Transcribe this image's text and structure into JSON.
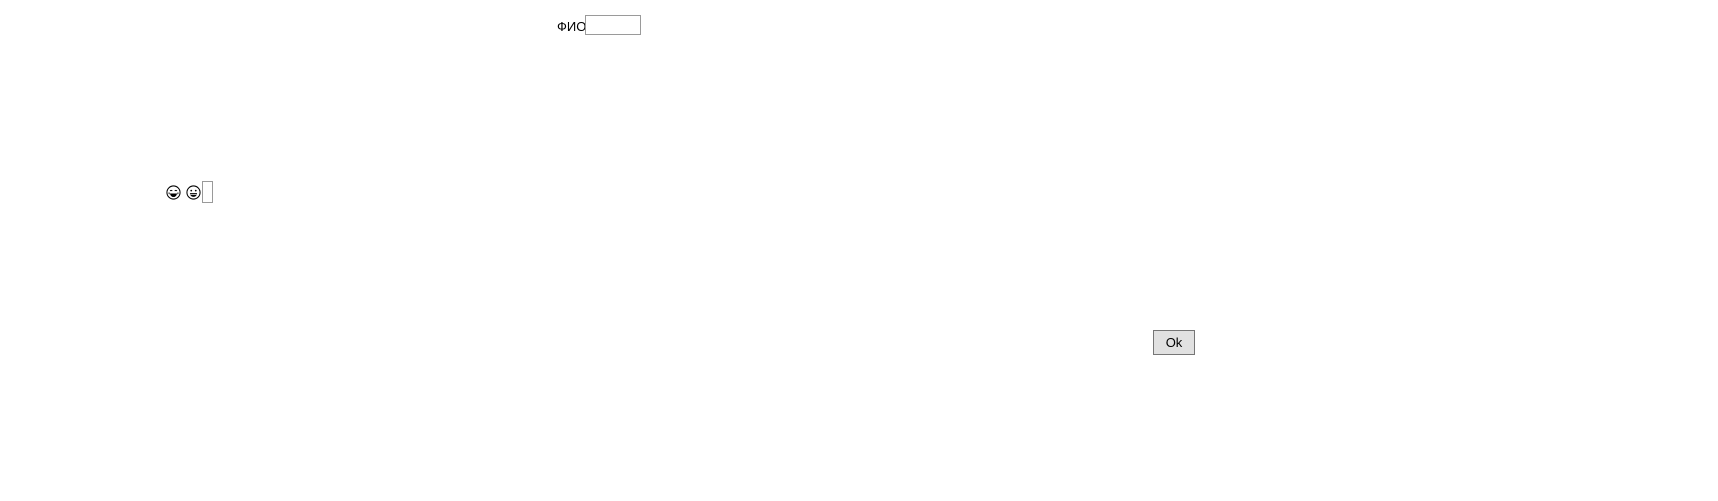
{
  "form": {
    "fio_label": "ФИО",
    "fio_value": "",
    "fio_placeholder": "",
    "emoji_icons": [
      "grinning-tears-face",
      "grinning-face"
    ],
    "emoji_value": "",
    "ok_label": "Ok"
  },
  "colors": {
    "background": "#ffffff",
    "input_border": "#9a9a9a",
    "button_background": "#e1e1e1",
    "button_border": "#767676"
  }
}
